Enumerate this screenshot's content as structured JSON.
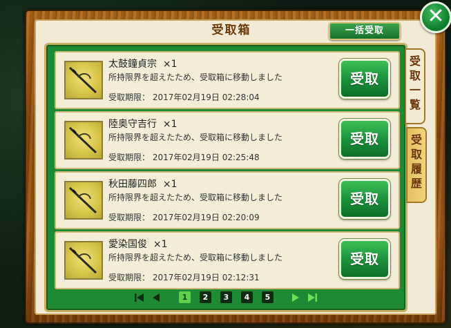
{
  "header": {
    "title": "受取箱",
    "bulk_button": "一括受取"
  },
  "close": {
    "label": "✕",
    "icon": "close-icon"
  },
  "tabs": [
    {
      "label": [
        "受",
        "取",
        "一",
        "覧"
      ],
      "active": true
    },
    {
      "label": [
        "受",
        "取",
        "履",
        "歴"
      ],
      "active": false
    }
  ],
  "items": [
    {
      "name": "太鼓鐘貞宗",
      "count": "×1",
      "message": "所持限界を超えたため、受取箱に移動しました",
      "deadline_label": "受取期限：",
      "deadline": "2017年02月19日 02:28:04",
      "button": "受取"
    },
    {
      "name": "陸奥守吉行",
      "count": "×1",
      "message": "所持限界を超えたため、受取箱に移動しました",
      "deadline_label": "受取期限：",
      "deadline": "2017年02月19日 02:25:48",
      "button": "受取"
    },
    {
      "name": "秋田藤四郎",
      "count": "×1",
      "message": "所持限界を超えたため、受取箱に移動しました",
      "deadline_label": "受取期限：",
      "deadline": "2017年02月19日 02:20:09",
      "button": "受取"
    },
    {
      "name": "愛染国俊",
      "count": "×1",
      "message": "所持限界を超えたため、受取箱に移動しました",
      "deadline_label": "受取期限：",
      "deadline": "2017年02月19日 02:12:31",
      "button": "受取"
    }
  ],
  "pagination": {
    "pages": [
      "1",
      "2",
      "3",
      "4",
      "5"
    ],
    "current": "1"
  },
  "colors": {
    "accent_green": "#18903a",
    "frame_wood": "#8e4d0e",
    "paper": "#f2ead4"
  }
}
